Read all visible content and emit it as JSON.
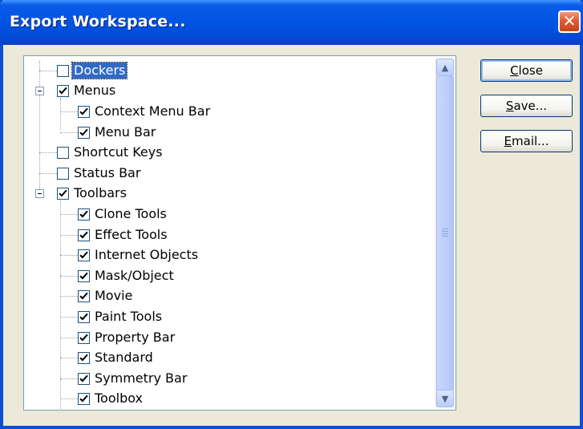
{
  "window": {
    "title": "Export Workspace...",
    "close_glyph": "✕"
  },
  "tree": {
    "items": [
      {
        "label": "Dockers",
        "checked": false,
        "selected": true
      },
      {
        "label": "Menus",
        "checked": true,
        "expanded": true
      },
      {
        "label": "Context Menu Bar",
        "checked": true
      },
      {
        "label": "Menu Bar",
        "checked": true
      },
      {
        "label": "Shortcut Keys",
        "checked": false
      },
      {
        "label": "Status Bar",
        "checked": false
      },
      {
        "label": "Toolbars",
        "checked": true,
        "expanded": true
      },
      {
        "label": "Clone Tools",
        "checked": true
      },
      {
        "label": "Effect Tools",
        "checked": true
      },
      {
        "label": "Internet Objects",
        "checked": true
      },
      {
        "label": "Mask/Object",
        "checked": true
      },
      {
        "label": "Movie",
        "checked": true
      },
      {
        "label": "Paint Tools",
        "checked": true
      },
      {
        "label": "Property Bar",
        "checked": true
      },
      {
        "label": "Standard",
        "checked": true
      },
      {
        "label": "Symmetry Bar",
        "checked": true
      },
      {
        "label": "Toolbox",
        "checked": true
      }
    ]
  },
  "scrollbar": {
    "up_glyph": "▲",
    "down_glyph": "▼"
  },
  "buttons": {
    "close": {
      "label": "Close",
      "mnemonic": "C"
    },
    "save": {
      "label": "Save...",
      "mnemonic": "S"
    },
    "email": {
      "label": "Email...",
      "mnemonic": "E"
    }
  }
}
